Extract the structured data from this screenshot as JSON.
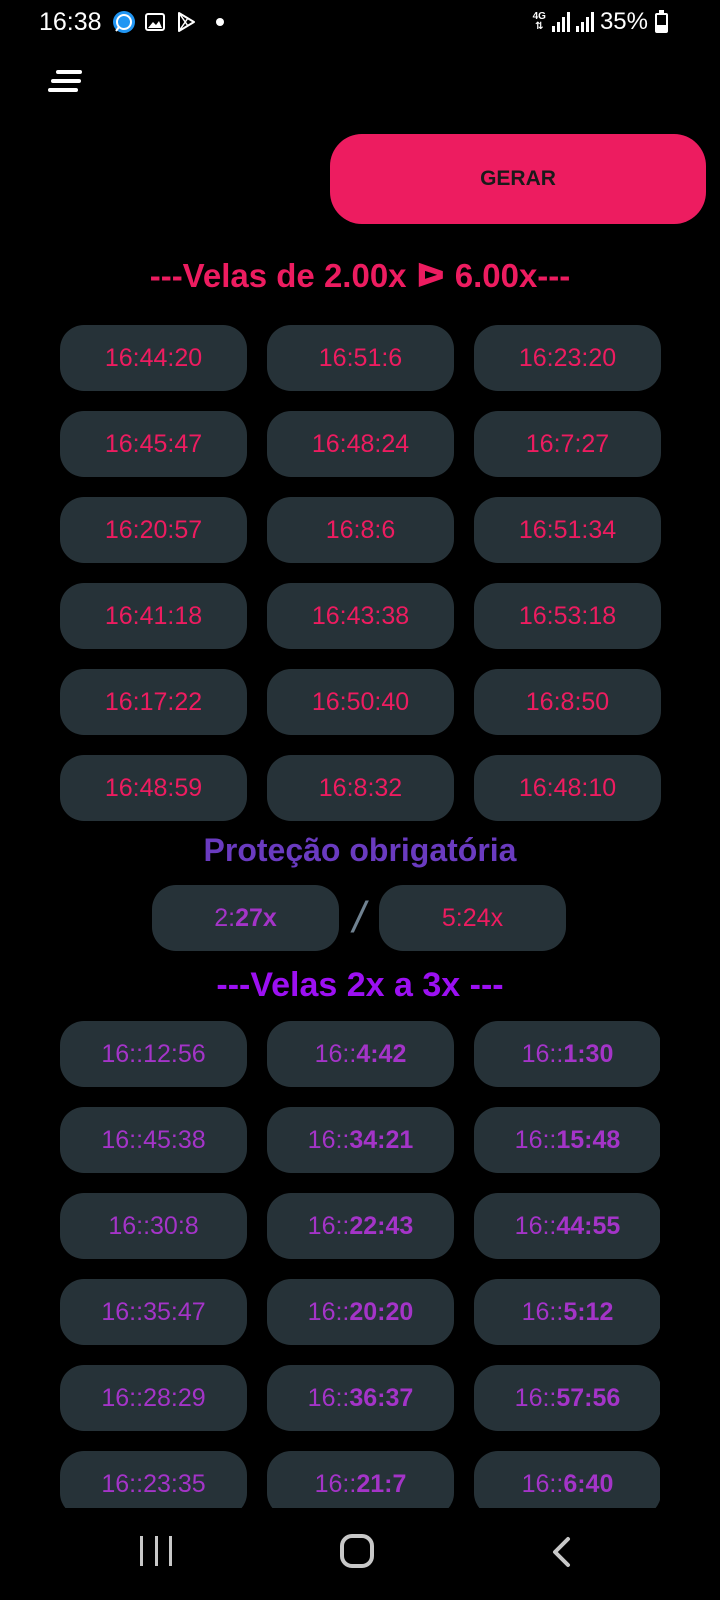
{
  "status_bar": {
    "time": "16:38",
    "network": "4G",
    "battery": "35%",
    "battery_level": 0.35
  },
  "toolbar": {
    "gerar_label": "GERAR"
  },
  "section1": {
    "title": "---Velas de 2.00x ᐅ 6.00x---",
    "times": [
      "16:44:20",
      "16:51:6",
      "16:23:20",
      "16:45:47",
      "16:48:24",
      "16:7:27",
      "16:20:57",
      "16:8:6",
      "16:51:34",
      "16:41:18",
      "16:43:38",
      "16:53:18",
      "16:17:22",
      "16:50:40",
      "16:8:50",
      "16:48:59",
      "16:8:32",
      "16:48:10"
    ]
  },
  "protection": {
    "title": "Proteção obrigatória",
    "left_prefix": "2:",
    "left_value": "27x",
    "separator": "/",
    "right_value": "5:24x"
  },
  "section2": {
    "title": "---Velas 2x a 3x ---",
    "prefix": "16::",
    "times": [
      "12:56",
      "4:42",
      "1:30",
      "45:38",
      "34:21",
      "15:48",
      "30:8",
      "22:43",
      "44:55",
      "35:47",
      "20:20",
      "5:12",
      "28:29",
      "36:37",
      "57:56",
      "23:35",
      "21:7",
      "6:40"
    ]
  },
  "colors": {
    "accent": "#ed1c60",
    "purple": "#a434c8",
    "violet": "#9c10f2",
    "cell_bg": "#263238"
  }
}
